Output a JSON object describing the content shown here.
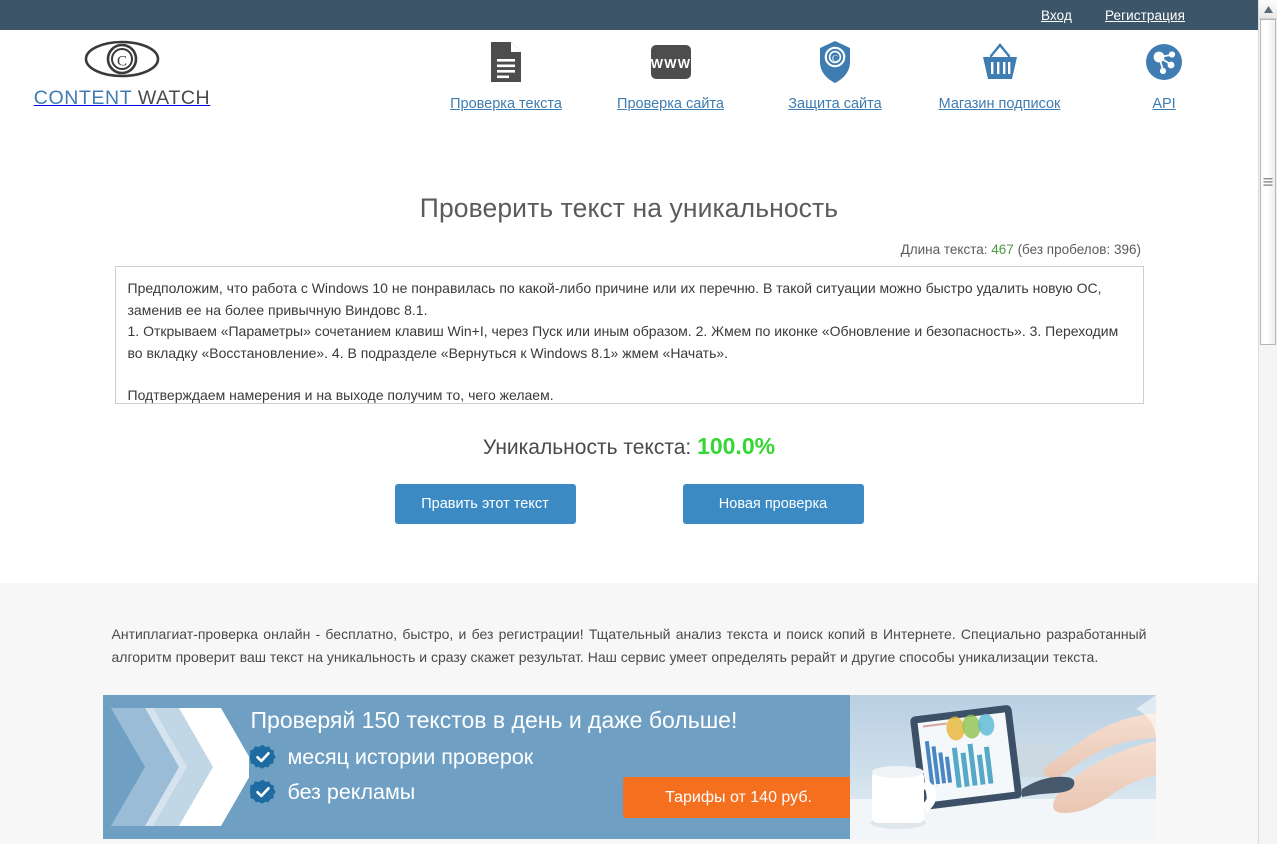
{
  "topbar": {
    "login_label": "Вход",
    "register_label": "Регистрация"
  },
  "logo": {
    "word1": "CONTENT",
    "word2": " WATCH",
    "icon": "eye-copyright-icon"
  },
  "nav": {
    "items": [
      {
        "label": "Проверка текста",
        "icon": "document-lines-icon"
      },
      {
        "label": "Проверка сайта",
        "icon": "www-icon"
      },
      {
        "label": "Защита сайта",
        "icon": "shield-copyright-icon"
      },
      {
        "label": "Магазин подписок",
        "icon": "basket-icon"
      },
      {
        "label": "API",
        "icon": "network-nodes-icon"
      }
    ]
  },
  "main": {
    "title": "Проверить текст на уникальность",
    "length_prefix": "Длина текста: ",
    "length_value": "467",
    "length_suffix": " (без пробелов: 396)",
    "text_lines": [
      "Предположим, что работа с Windows 10 не понравилась по какой-либо причине или их перечню. В такой ситуации можно быстро удалить новую ОС, заменив ее на более привычную Виндовс 8.1.",
      "1. Открываем «Параметры» сочетанием клавиш Win+I, через Пуск или иным образом. 2. Жмем по иконке «Обновление и безопасность». 3. Переходим во вкладку «Восстановление». 4. В подразделе «Вернуться к Windows 8.1» жмем «Начать».",
      "Подтверждаем намерения и на выходе получим то, чего желаем."
    ],
    "result_label": "Уникальность текста: ",
    "result_value": "100.0%",
    "edit_button": "Править этот текст",
    "new_check_button": "Новая проверка"
  },
  "footer": {
    "promo_text": "Антиплагиат-проверка онлайн - бесплатно, быстро, и без регистрации! Тщательный анализ текста и поиск копий в Интернете. Специально разработанный алгоритм проверит ваш текст на уникальность и сразу скажет результат. Наш сервис умеет определять рерайт и другие способы уникализации текста."
  },
  "banner": {
    "headline": "Проверяй 150 текстов в день и даже больше!",
    "features": [
      "месяц истории проверок",
      "без рекламы"
    ],
    "cta_label": "Тарифы от 140 руб."
  },
  "colors": {
    "topbar": "#3d5568",
    "link_blue": "#3e7cb1",
    "button_blue": "#3b8ac4",
    "result_green": "#34d734",
    "count_green": "#4a9c3f",
    "banner_bg": "#6fa0c4",
    "cta_orange": "#f4701f",
    "gray_band": "#f7f7f7"
  }
}
